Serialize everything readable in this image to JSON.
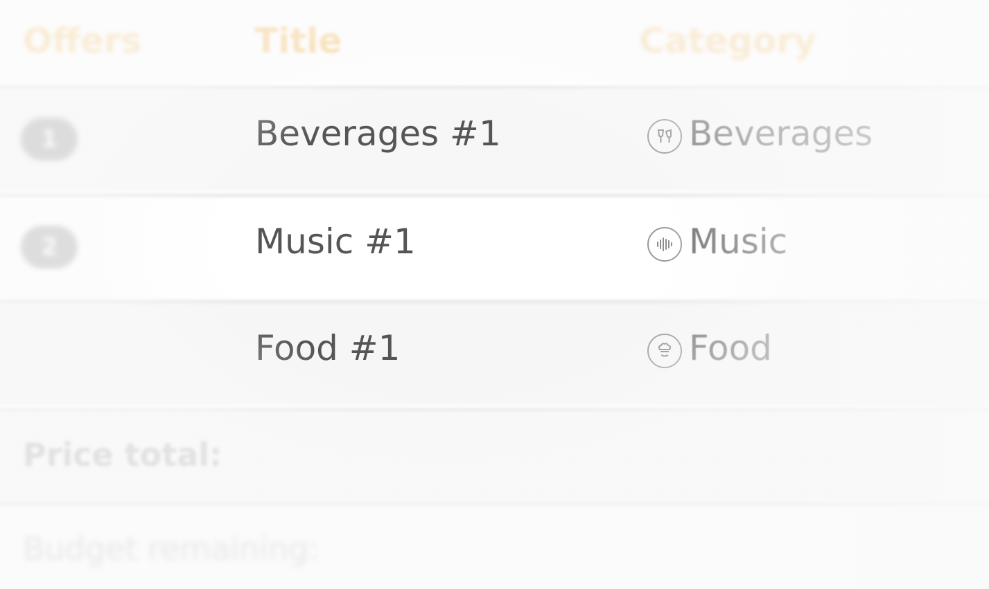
{
  "table": {
    "headers": {
      "offers": "Offers",
      "title": "Title",
      "category": "Category"
    },
    "rows": [
      {
        "offer": "1",
        "title": "Beverages #1",
        "category": "Beverages",
        "icon": "glasses-toast-icon"
      },
      {
        "offer": "2",
        "title": "Music #1",
        "category": "Music",
        "icon": "sound-wave-icon"
      },
      {
        "offer": "",
        "title": "Food #1",
        "category": "Food",
        "icon": "chef-icon"
      }
    ]
  },
  "summary": {
    "price_total_label": "Price total:",
    "budget_remaining_label": "Budget remaining:"
  },
  "colors": {
    "accent": "#f7c06a",
    "badge": "#a9a9a9"
  }
}
